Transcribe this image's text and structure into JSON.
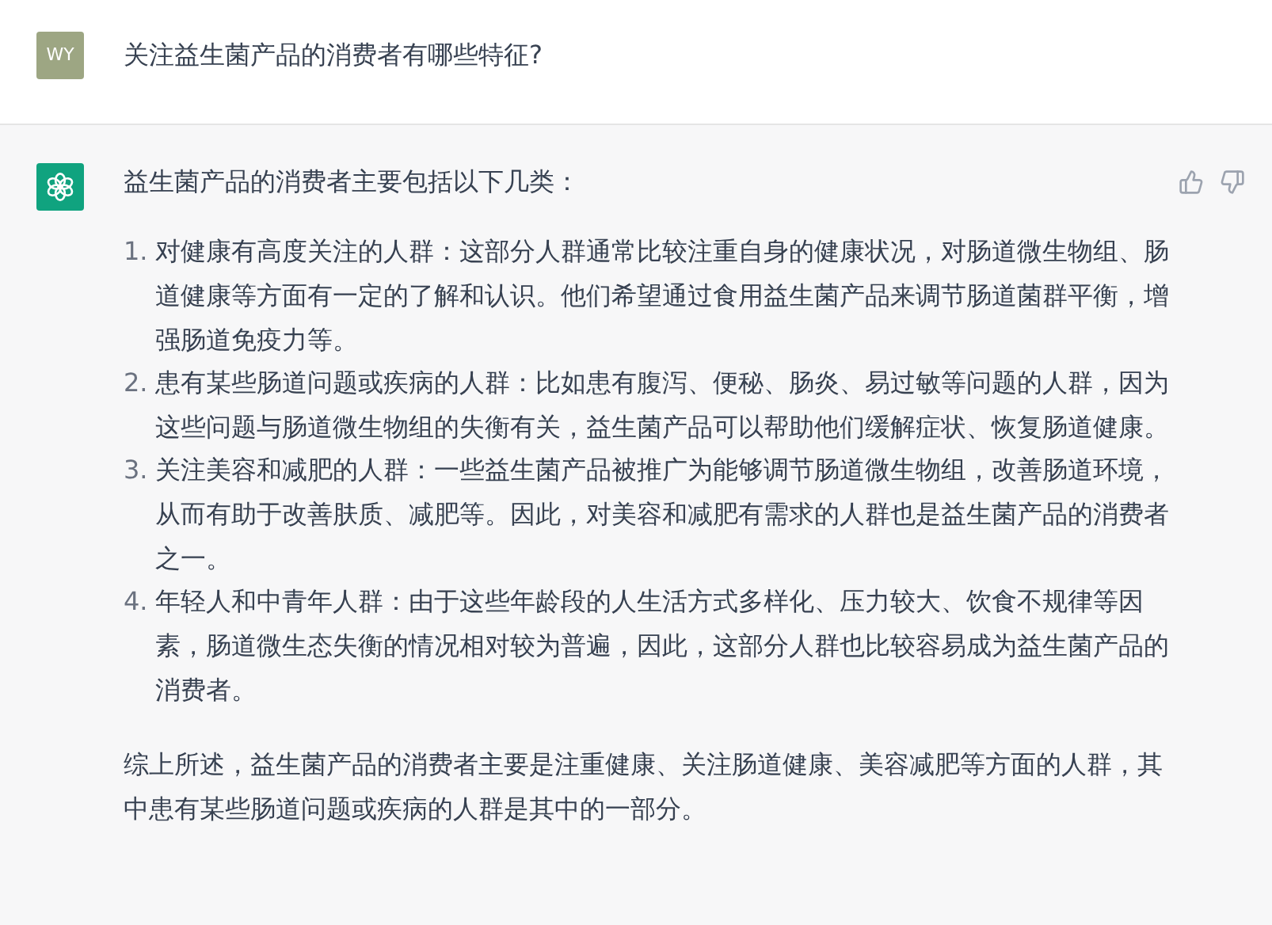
{
  "user_message": {
    "avatar": "WY",
    "text": "关注益生菌产品的消费者有哪些特征?"
  },
  "assistant_message": {
    "intro": "益生菌产品的消费者主要包括以下几类：",
    "items": [
      {
        "number": "1.",
        "text": "对健康有高度关注的人群：这部分人群通常比较注重自身的健康状况，对肠道微生物组、肠道健康等方面有一定的了解和认识。他们希望通过食用益生菌产品来调节肠道菌群平衡，增强肠道免疫力等。"
      },
      {
        "number": "2.",
        "text": "患有某些肠道问题或疾病的人群：比如患有腹泻、便秘、肠炎、易过敏等问题的人群，因为这些问题与肠道微生物组的失衡有关，益生菌产品可以帮助他们缓解症状、恢复肠道健康。"
      },
      {
        "number": "3.",
        "text": "关注美容和减肥的人群：一些益生菌产品被推广为能够调节肠道微生物组，改善肠道环境，从而有助于改善肤质、减肥等。因此，对美容和减肥有需求的人群也是益生菌产品的消费者之一。"
      },
      {
        "number": "4.",
        "text": "年轻人和中青年人群：由于这些年龄段的人生活方式多样化、压力较大、饮食不规律等因素，肠道微生态失衡的情况相对较为普遍，因此，这部分人群也比较容易成为益生菌产品的消费者。"
      }
    ],
    "summary": "综上所述，益生菌产品的消费者主要是注重健康、关注肠道健康、美容减肥等方面的人群，其中患有某些肠道问题或疾病的人群是其中的一部分。"
  }
}
